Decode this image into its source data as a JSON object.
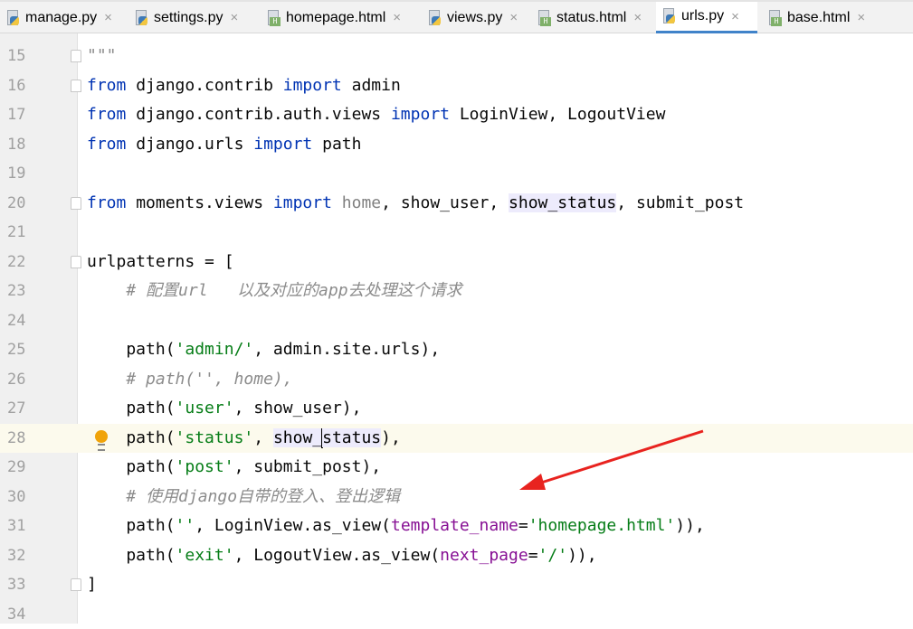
{
  "tabs": [
    {
      "label": "manage.py",
      "type": "py",
      "active": false
    },
    {
      "label": "settings.py",
      "type": "py",
      "active": false
    },
    {
      "label": "homepage.html",
      "type": "html",
      "active": false
    },
    {
      "label": "views.py",
      "type": "py",
      "active": false
    },
    {
      "label": "status.html",
      "type": "html",
      "active": false
    },
    {
      "label": "urls.py",
      "type": "py",
      "active": true
    },
    {
      "label": "base.html",
      "type": "html",
      "active": false
    }
  ],
  "close_glyph": "×",
  "html_badge": "H",
  "accent_color": "#4083c9",
  "current_line": 28,
  "lines": [
    {
      "n": "15",
      "fold": true,
      "seg": [
        [
          "cm",
          "\"\"\""
        ]
      ]
    },
    {
      "n": "16",
      "fold": true,
      "seg": [
        [
          "kw",
          "from"
        ],
        [
          "pl",
          " django.contrib "
        ],
        [
          "kw",
          "import"
        ],
        [
          "pl",
          " admin"
        ]
      ]
    },
    {
      "n": "17",
      "seg": [
        [
          "kw",
          "from"
        ],
        [
          "pl",
          " django.contrib.auth.views "
        ],
        [
          "kw",
          "import"
        ],
        [
          "pl",
          " LoginView, LogoutView"
        ]
      ]
    },
    {
      "n": "18",
      "seg": [
        [
          "kw",
          "from"
        ],
        [
          "pl",
          " django.urls "
        ],
        [
          "kw",
          "import"
        ],
        [
          "pl",
          " path"
        ]
      ]
    },
    {
      "n": "19",
      "seg": []
    },
    {
      "n": "20",
      "fold": true,
      "seg": [
        [
          "kw",
          "from"
        ],
        [
          "pl",
          " moments.views "
        ],
        [
          "kw",
          "import"
        ],
        [
          "pl",
          " "
        ],
        [
          "unused",
          "home"
        ],
        [
          "pl",
          ", show_user, "
        ],
        [
          "hl",
          "show_status"
        ],
        [
          "pl",
          ", submit_post"
        ]
      ]
    },
    {
      "n": "21",
      "seg": []
    },
    {
      "n": "22",
      "fold": true,
      "seg": [
        [
          "pl",
          "urlpatterns = ["
        ]
      ]
    },
    {
      "n": "23",
      "seg": [
        [
          "cm",
          "    # 配置url   以及对应的app去处理这个请求"
        ]
      ]
    },
    {
      "n": "24",
      "seg": []
    },
    {
      "n": "25",
      "seg": [
        [
          "pl",
          "    path("
        ],
        [
          "str",
          "'admin/'"
        ],
        [
          "pl",
          ", admin.site.urls),"
        ]
      ]
    },
    {
      "n": "26",
      "seg": [
        [
          "cm",
          "    # path('', home),"
        ]
      ]
    },
    {
      "n": "27",
      "seg": [
        [
          "pl",
          "    path("
        ],
        [
          "str",
          "'user'"
        ],
        [
          "pl",
          ", show_user),"
        ]
      ]
    },
    {
      "n": "28",
      "bulb": true,
      "seg": [
        [
          "pl",
          "    path("
        ],
        [
          "str",
          "'status'"
        ],
        [
          "pl",
          ", "
        ],
        [
          "hl",
          "show_"
        ],
        [
          "caret",
          ""
        ],
        [
          "hl",
          "status"
        ],
        [
          "pl",
          "),"
        ]
      ]
    },
    {
      "n": "29",
      "seg": [
        [
          "pl",
          "    path("
        ],
        [
          "str",
          "'post'"
        ],
        [
          "pl",
          ", submit_post),"
        ]
      ]
    },
    {
      "n": "30",
      "seg": [
        [
          "cm",
          "    # 使用django自带的登入、登出逻辑"
        ]
      ]
    },
    {
      "n": "31",
      "seg": [
        [
          "pl",
          "    path("
        ],
        [
          "str",
          "''"
        ],
        [
          "pl",
          ", LoginView.as_view("
        ],
        [
          "kwarg",
          "template_name"
        ],
        [
          "pl",
          "="
        ],
        [
          "str",
          "'homepage.html'"
        ],
        [
          "pl",
          ")),"
        ]
      ]
    },
    {
      "n": "32",
      "seg": [
        [
          "pl",
          "    path("
        ],
        [
          "str",
          "'exit'"
        ],
        [
          "pl",
          ", LogoutView.as_view("
        ],
        [
          "kwarg",
          "next_page"
        ],
        [
          "pl",
          "="
        ],
        [
          "str",
          "'/'"
        ],
        [
          "pl",
          ")),"
        ]
      ]
    },
    {
      "n": "33",
      "fold": true,
      "seg": [
        [
          "pl",
          "]"
        ]
      ]
    },
    {
      "n": "34",
      "seg": []
    }
  ],
  "annotation_arrow_color": "#e8231f"
}
